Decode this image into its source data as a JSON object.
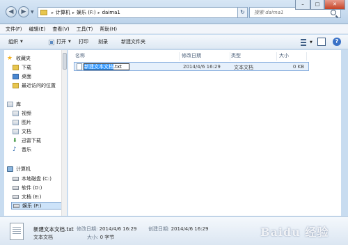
{
  "nav": {
    "back_glyph": "◀",
    "forward_glyph": "▶",
    "history_glyph": "▼"
  },
  "address": {
    "crumbs": [
      "计算机",
      "娱乐 (F:)",
      "daima1"
    ],
    "separator": "▸",
    "refresh_glyph": "↻"
  },
  "search": {
    "placeholder": "搜索 daima1"
  },
  "window_controls": {
    "min": "–",
    "max": "□",
    "close": "✕"
  },
  "menubar": [
    "文件(F)",
    "编辑(E)",
    "查看(V)",
    "工具(T)",
    "帮助(H)"
  ],
  "toolbar": {
    "organize": "组织",
    "open": "打开",
    "print": "打印",
    "burn": "刻录",
    "new_folder": "新建文件夹",
    "caret": "▼",
    "help": "?"
  },
  "sidebar": {
    "favorites": {
      "label": "收藏夹",
      "items": [
        "下载",
        "桌面",
        "最近访问的位置"
      ]
    },
    "libraries": {
      "label": "库",
      "items": [
        "视频",
        "图片",
        "文档",
        "迅雷下载",
        "音乐"
      ]
    },
    "computer": {
      "label": "计算机",
      "items": [
        "本地磁盘 (C:)",
        "软件 (D:)",
        "文档 (E:)",
        "娱乐 (F:)"
      ],
      "selected_index": 3
    }
  },
  "columns": {
    "name": "名称",
    "date": "修改日期",
    "type": "类型",
    "size": "大小"
  },
  "file": {
    "rename_selected": "新建文本文档",
    "rename_extension": ".txt",
    "modified": "2014/4/6 16:29",
    "type": "文本文档",
    "size": "0 KB"
  },
  "details": {
    "name": "新建文本文档.txt",
    "type": "文本文档",
    "modified_label": "修改日期:",
    "modified_value": "2014/4/6 16:29",
    "size_label": "大小:",
    "size_value": "0 字节",
    "created_label": "创建日期:",
    "created_value": "2014/4/6 16:29"
  },
  "watermark": {
    "text": "Baidu 经验"
  }
}
